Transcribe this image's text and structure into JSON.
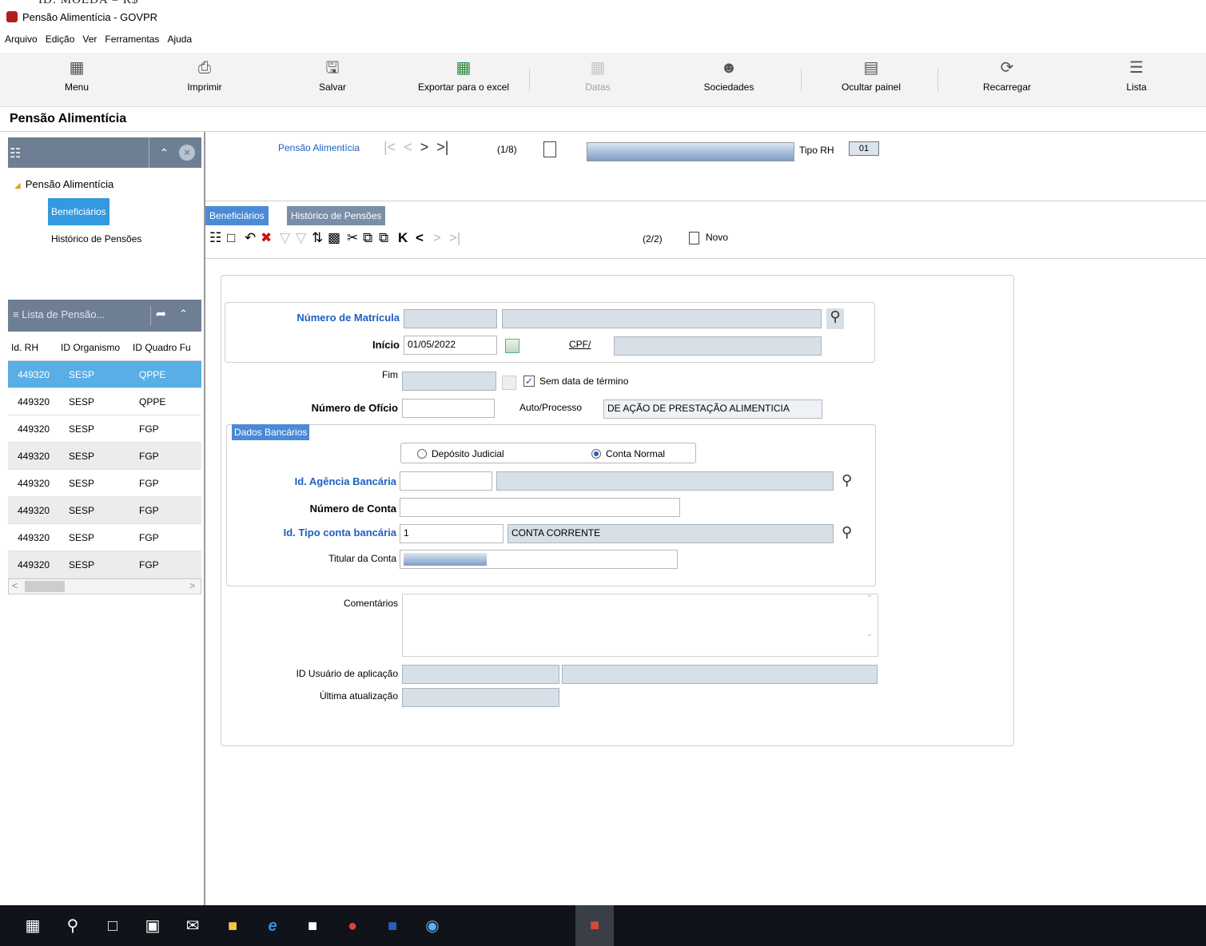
{
  "window": {
    "title_cut": "ID: MOEDA = R$",
    "title": "Pensão Alimentícia - GOVPR"
  },
  "menu": [
    "Arquivo",
    "Edição",
    "Ver",
    "Ferramentas",
    "Ajuda"
  ],
  "toolbar": {
    "menu": "Menu",
    "imprimir": "Imprimir",
    "salvar": "Salvar",
    "exportar": "Exportar para o excel",
    "datas": "Datas",
    "sociedades": "Sociedades",
    "ocultar": "Ocultar painel",
    "recarregar": "Recarregar",
    "lista": "Lista"
  },
  "page_title": "Pensão Alimentícia",
  "tree": {
    "root": "Pensão Alimentícia",
    "items": [
      "Beneficiários",
      "Histórico de Pensões"
    ]
  },
  "list": {
    "title": "Lista de Pensão...",
    "columns": [
      "Id. RH",
      "ID Organismo",
      "ID Quadro Fu"
    ],
    "rows": [
      [
        "449320",
        "SESP",
        "QPPE"
      ],
      [
        "449320",
        "SESP",
        "QPPE"
      ],
      [
        "449320",
        "SESP",
        "FGP"
      ],
      [
        "449320",
        "SESP",
        "FGP"
      ],
      [
        "449320",
        "SESP",
        "FGP"
      ],
      [
        "449320",
        "SESP",
        "FGP"
      ],
      [
        "449320",
        "SESP",
        "FGP"
      ],
      [
        "449320",
        "SESP",
        "FGP"
      ]
    ]
  },
  "nav": {
    "label": "Pensão Alimentícia",
    "count": "(1/8)",
    "tipo_label": "Tipo RH",
    "tipo_value": "01"
  },
  "tabs": [
    "Beneficiários",
    "Histórico de Pensões"
  ],
  "subnav": {
    "count": "(2/2)",
    "new_label": "Novo"
  },
  "form": {
    "matricula_label": "Número de Matrícula",
    "inicio_label": "Início",
    "inicio_value": "01/05/2022",
    "cpf_label": "CPF/",
    "fim_label": "Fim",
    "sem_data_label": "Sem data de término",
    "oficio_label": "Número de Ofício",
    "auto_label": "Auto/Processo",
    "auto_value": "DE AÇÃO DE PRESTAÇÃO ALIMENTICIA",
    "bancarios_label": "Dados Bancários",
    "radio_deposito": "Depósito Judicial",
    "radio_conta": "Conta Normal",
    "agencia_label": "Id. Agência Bancária",
    "conta_label": "Número de Conta",
    "tipo_conta_label": "Id. Tipo conta bancária",
    "tipo_conta_value": "1",
    "tipo_conta_desc": "CONTA CORRENTE",
    "titular_label": "Titular da Conta",
    "comentarios_label": "Comentários",
    "usuario_label": "ID Usuário de aplicação",
    "atualizacao_label": "Última atualização"
  }
}
